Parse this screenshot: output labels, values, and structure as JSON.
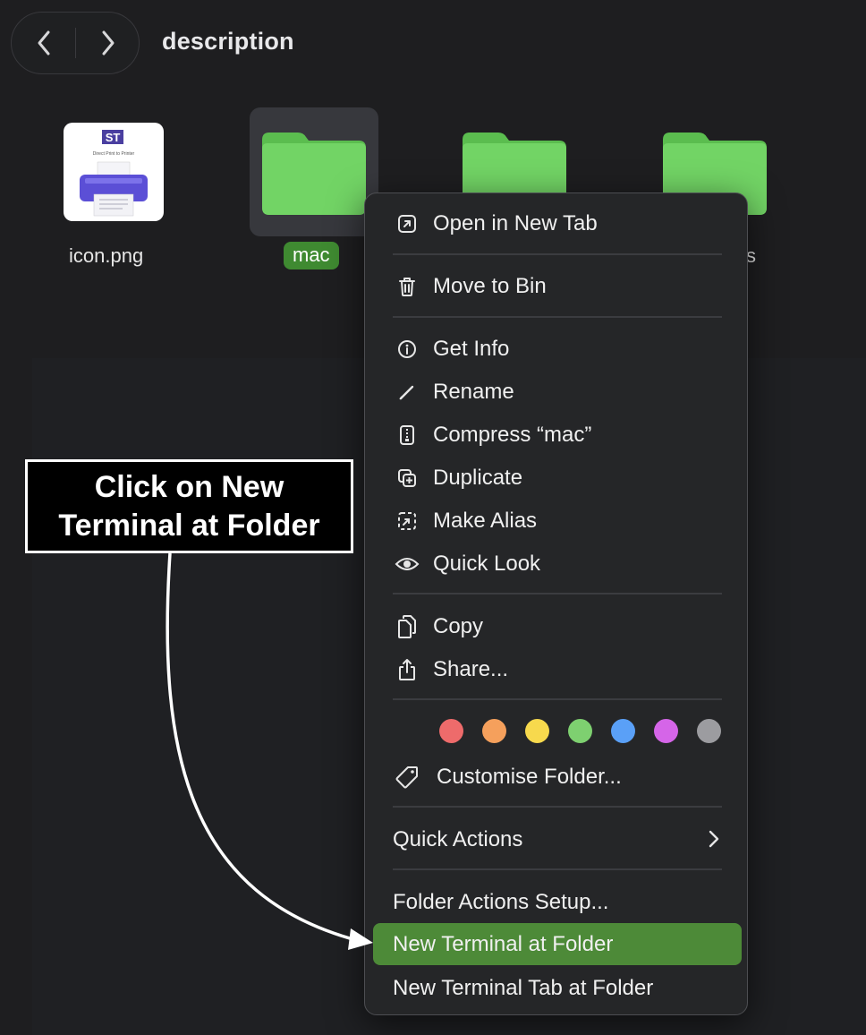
{
  "window": {
    "title": "description"
  },
  "navigation": {
    "back_icon": "chevron-left-icon",
    "forward_icon": "chevron-right-icon"
  },
  "files": [
    {
      "name": "icon.png",
      "type": "image",
      "thumbnail_text": "Direct Print to Printer"
    },
    {
      "name": "mac",
      "type": "folder",
      "selected": true
    },
    {
      "name": "",
      "type": "folder"
    },
    {
      "name": "s",
      "type": "folder"
    }
  ],
  "context_menu": {
    "items": [
      {
        "label": "Open in New Tab",
        "icon": "open-in-tab-icon"
      },
      {
        "label": "Move to Bin",
        "icon": "trash-icon"
      },
      {
        "label": "Get Info",
        "icon": "info-icon"
      },
      {
        "label": "Rename",
        "icon": "pencil-icon"
      },
      {
        "label": "Compress “mac”",
        "icon": "archive-icon"
      },
      {
        "label": "Duplicate",
        "icon": "duplicate-icon"
      },
      {
        "label": "Make Alias",
        "icon": "alias-icon"
      },
      {
        "label": "Quick Look",
        "icon": "eye-icon"
      },
      {
        "label": "Copy",
        "icon": "copy-icon"
      },
      {
        "label": "Share...",
        "icon": "share-icon"
      },
      {
        "label": "Customise Folder...",
        "icon": "tag-icon"
      },
      {
        "label": "Quick Actions",
        "icon": "chevron-right-icon"
      },
      {
        "label": "Folder Actions Setup..."
      },
      {
        "label": "New Terminal at Folder",
        "highlighted": true
      },
      {
        "label": "New Terminal Tab at Folder"
      }
    ],
    "tag_colors": [
      "#ee6b6b",
      "#f5a05c",
      "#f7d94d",
      "#7ed070",
      "#5aa0f7",
      "#d565e8",
      "#9c9ca0"
    ],
    "highlight_color": "#4d8a38"
  },
  "annotation": {
    "lines": [
      "Click on New",
      "Terminal at Folder"
    ]
  }
}
